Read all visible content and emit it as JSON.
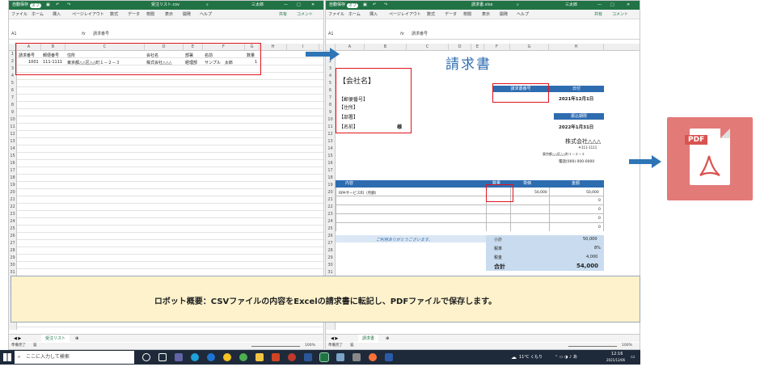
{
  "left_window": {
    "autosave": "自動保存",
    "autosave_state": "オフ",
    "filename": "受注リスト.csv",
    "user": "三太郎",
    "menu": [
      "ファイル",
      "ホーム",
      "挿入",
      "ページレイアウト",
      "数式",
      "データ",
      "校閲",
      "表示",
      "開発",
      "ヘルプ"
    ],
    "share": "共有",
    "comment": "コメント",
    "namebox": "A1",
    "fx": "fx",
    "formula": "請求番号",
    "columns": [
      "A",
      "B",
      "C",
      "D",
      "E",
      "F",
      "G",
      "H",
      "I"
    ],
    "header_row": [
      "請求番号",
      "郵便番号",
      "住所",
      "会社名",
      "部署",
      "名前",
      "数量"
    ],
    "data_row": [
      "1001",
      "111-1111",
      "東京都△△区△△町１－２－３",
      "株式会社△△△",
      "経理部",
      "サンプル　太郎",
      "1"
    ],
    "rows": [
      "1",
      "2",
      "3",
      "4",
      "5",
      "6",
      "7",
      "8",
      "9",
      "10",
      "11",
      "12",
      "13",
      "14",
      "15",
      "16",
      "17",
      "18",
      "19",
      "20",
      "21",
      "22",
      "23",
      "24",
      "25",
      "26",
      "27",
      "28",
      "29",
      "30",
      "31",
      "32",
      "33",
      "34"
    ],
    "sheet_tab": "受注リスト",
    "status_left": "準備完了",
    "status_left2": "猫",
    "zoom": "100%"
  },
  "right_window": {
    "autosave": "自動保存",
    "autosave_state": "オフ",
    "filename": "請求書.xlsx",
    "user": "三太郎",
    "menu": [
      "ファイル",
      "ホーム",
      "挿入",
      "ページレイアウト",
      "数式",
      "データ",
      "校閲",
      "表示",
      "開発",
      "ヘルプ"
    ],
    "share": "共有",
    "comment": "コメント",
    "namebox": "A1",
    "fx": "fx",
    "formula": "請求番号",
    "columns": [
      "A",
      "B",
      "C",
      "D",
      "E",
      "F",
      "G",
      "H"
    ],
    "rows": [
      "1",
      "2",
      "3",
      "4",
      "5",
      "6",
      "7",
      "8",
      "9",
      "10",
      "11",
      "12",
      "13",
      "14",
      "15",
      "16",
      "17",
      "18",
      "19",
      "20",
      "21",
      "22",
      "23",
      "24",
      "25",
      "26",
      "27",
      "28",
      "29",
      "30",
      "31",
      "32",
      "33",
      "34"
    ],
    "invoice": {
      "title": "請求書",
      "company_label": "【会社名】",
      "postal_label": "【郵便番号】",
      "address_label": "【住所】",
      "dept_label": "【部署】",
      "name_label": "【名前】",
      "sama": "様",
      "invoice_no_label": "請求書番号",
      "date_label": "日付",
      "date_value": "2021年12月1日",
      "due_label": "振込期限",
      "due_value": "2022年1月31日",
      "issuer": "株式会社△△△",
      "issuer_zip": "〒111-1111",
      "issuer_addr": "東京都△△区△△町１－２－３",
      "issuer_tel": "電話(000) 000-0000",
      "col_content": "内容",
      "col_qty": "数量",
      "col_price": "単価",
      "col_amount": "金額",
      "item": "RPAサービス料（月額）",
      "item_price": "50,000",
      "item_amount": "50,000",
      "zeros": [
        "0",
        "0",
        "0",
        "0"
      ],
      "thanks": "ご利用ありがとうございます。",
      "subtotal_label": "小計",
      "subtotal": "50,000",
      "taxrate_label": "税率",
      "taxrate": "8%",
      "tax_label": "税金",
      "tax": "4,000",
      "total_label": "合計",
      "total": "54,000"
    },
    "sheet_tab": "請求書",
    "status_left": "準備完了",
    "status_left2": "猫",
    "zoom": "100%"
  },
  "overlay_text": "ロボット概要：CSVファイルの内容をExcelの請求書に転記し、PDFファイルで保存します。",
  "pdf_label": "PDF",
  "taskbar": {
    "search": "ここに入力して検索",
    "weather": "11°C くもり",
    "time": "12:16",
    "date": "2021/12/06"
  }
}
